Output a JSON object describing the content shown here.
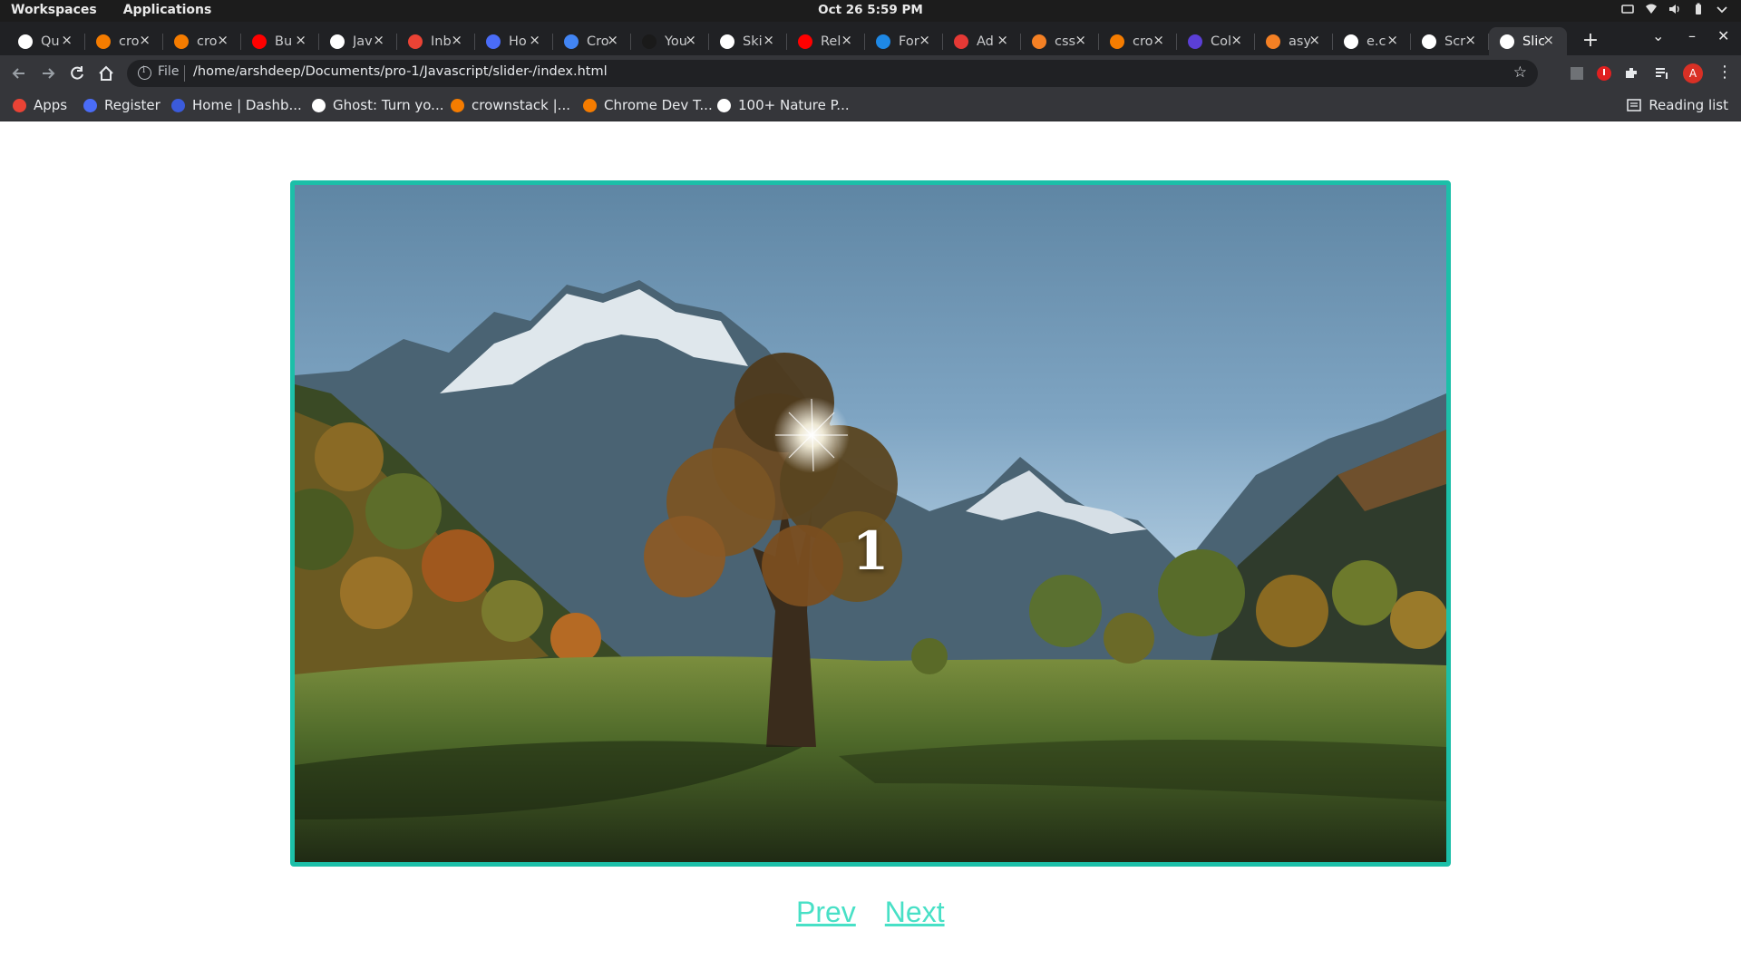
{
  "topbar": {
    "workspaces": "Workspaces",
    "applications": "Applications",
    "clock": "Oct 26  5:59 PM"
  },
  "tabs": [
    {
      "title": "Qu",
      "icon": "globe-icon",
      "color": "#ffffff"
    },
    {
      "title": "cro",
      "icon": "crownstack-icon",
      "color": "#f57c00"
    },
    {
      "title": "cro",
      "icon": "crownstack-icon",
      "color": "#f57c00"
    },
    {
      "title": "Bu",
      "icon": "youtube-icon",
      "color": "#ff0000"
    },
    {
      "title": "Jav",
      "icon": "bookmark-icon",
      "color": "#ffffff"
    },
    {
      "title": "Inb",
      "icon": "gmail-icon",
      "color": "#ea4335"
    },
    {
      "title": "Ho",
      "icon": "k-icon",
      "color": "#4a6cf7"
    },
    {
      "title": "Cro",
      "icon": "calendar-icon",
      "color": "#4285f4"
    },
    {
      "title": "You",
      "icon": "github-icon",
      "color": "#1a1a1a"
    },
    {
      "title": "Ski",
      "icon": "globe-icon",
      "color": "#ffffff"
    },
    {
      "title": "Rel",
      "icon": "youtube-icon",
      "color": "#ff0000"
    },
    {
      "title": "For",
      "icon": "k-icon",
      "color": "#1e88e5"
    },
    {
      "title": "Ad",
      "icon": "asterisk-icon",
      "color": "#e53935"
    },
    {
      "title": "css",
      "icon": "stackoverflow-icon",
      "color": "#f48024"
    },
    {
      "title": "cro",
      "icon": "crownstack-icon",
      "color": "#f57c00"
    },
    {
      "title": "Col",
      "icon": "c-icon",
      "color": "#5b3fd6"
    },
    {
      "title": "asy",
      "icon": "stackoverflow-icon",
      "color": "#f48024"
    },
    {
      "title": "e.c",
      "icon": "google-icon",
      "color": "#ffffff"
    },
    {
      "title": "Scr",
      "icon": "globe-icon",
      "color": "#ffffff"
    },
    {
      "title": "Slic",
      "icon": "globe-icon",
      "color": "#ffffff",
      "active": true
    }
  ],
  "address": {
    "scheme": "File",
    "url": "/home/arshdeep/Documents/pro-1/Javascript/slider-/index.html"
  },
  "bookmarks": [
    {
      "label": "Apps",
      "icon": "apps-grid-icon",
      "color": "#ea4335"
    },
    {
      "label": "Register",
      "icon": "k-icon",
      "color": "#4a6cf7"
    },
    {
      "label": "Home | Dashb...",
      "icon": "k-icon",
      "color": "#3b5bdb"
    },
    {
      "label": "Ghost: Turn yo...",
      "icon": "ghost-icon",
      "color": "#ffffff"
    },
    {
      "label": "crownstack |...",
      "icon": "crownstack-icon",
      "color": "#f57c00"
    },
    {
      "label": "Chrome Dev T...",
      "icon": "crownstack-icon",
      "color": "#f57c00"
    },
    {
      "label": "100+ Nature P...",
      "icon": "unsplash-icon",
      "color": "#ffffff"
    }
  ],
  "reading_list": "Reading list",
  "profile_initial": "A",
  "slider": {
    "current_slide": "1",
    "image_alt": "Mountain valley with autumn tree and sun"
  },
  "controls": {
    "prev": "Prev",
    "next": "Next"
  },
  "colors": {
    "slider_border": "#1cbfa8",
    "link": "#48e0c6"
  }
}
